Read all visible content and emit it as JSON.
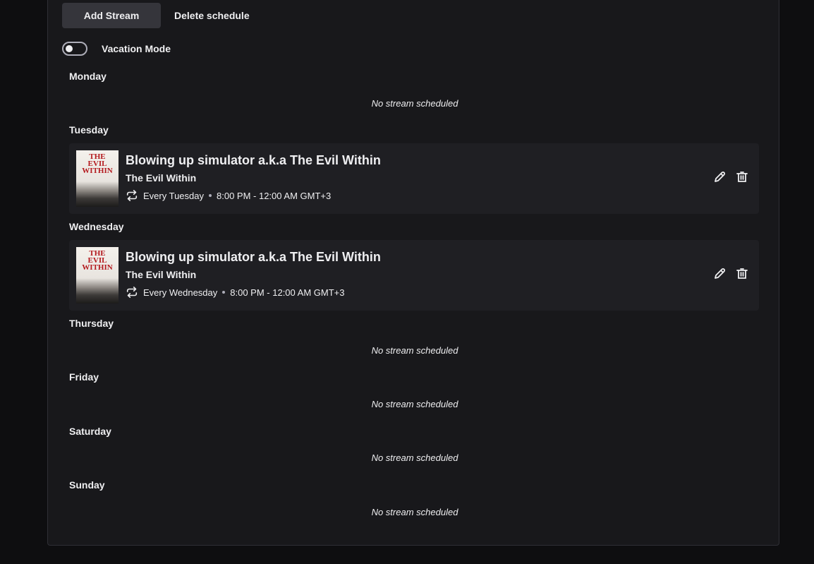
{
  "toolbar": {
    "add_label": "Add Stream",
    "delete_label": "Delete schedule"
  },
  "vacation": {
    "label": "Vacation Mode",
    "enabled": false
  },
  "days": [
    {
      "label": "Monday",
      "empty_text": "No stream scheduled"
    },
    {
      "label": "Tuesday"
    },
    {
      "label": "Wednesday"
    },
    {
      "label": "Thursday",
      "empty_text": "No stream scheduled"
    },
    {
      "label": "Friday",
      "empty_text": "No stream scheduled"
    },
    {
      "label": "Saturday",
      "empty_text": "No stream scheduled"
    },
    {
      "label": "Sunday",
      "empty_text": "No stream scheduled"
    }
  ],
  "streams": {
    "tuesday": {
      "title": "Blowing up simulator a.k.a The Evil Within",
      "game": "The Evil Within",
      "recurrence": "Every Tuesday",
      "time": "8:00 PM - 12:00 AM GMT+3",
      "cover_text": [
        "THE",
        "EVIL",
        "WITHIN"
      ]
    },
    "wednesday": {
      "title": "Blowing up simulator a.k.a The Evil Within",
      "game": "The Evil Within",
      "recurrence": "Every Wednesday",
      "time": "8:00 PM - 12:00 AM GMT+3",
      "cover_text": [
        "THE",
        "EVIL",
        "WITHIN"
      ]
    }
  },
  "icons": {
    "repeat": "repeat-icon",
    "edit": "pencil-icon",
    "delete": "trash-icon"
  }
}
